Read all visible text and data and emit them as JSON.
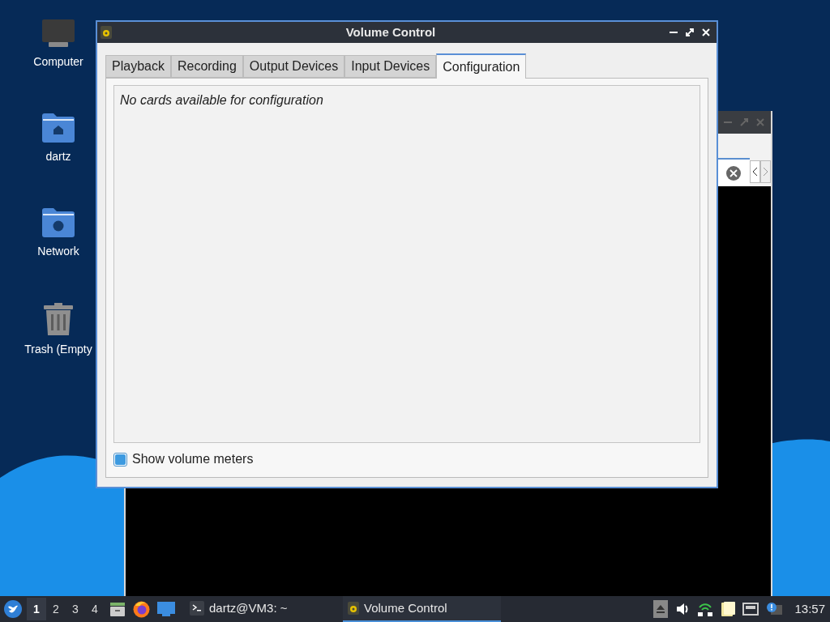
{
  "desktop_icons": [
    {
      "kind": "computer",
      "label": "Computer"
    },
    {
      "kind": "home",
      "label": "dartz"
    },
    {
      "kind": "network",
      "label": "Network"
    },
    {
      "kind": "trash",
      "label": "Trash (Empty"
    }
  ],
  "window": {
    "title": "Volume Control",
    "tabs": [
      {
        "label": "Playback",
        "selected": false
      },
      {
        "label": "Recording",
        "selected": false
      },
      {
        "label": "Output Devices",
        "selected": false
      },
      {
        "label": "Input Devices",
        "selected": false
      },
      {
        "label": "Configuration",
        "selected": true
      }
    ],
    "message": "No cards available for configuration",
    "show_meters": {
      "label": "Show volume meters",
      "checked": true
    }
  },
  "taskbar": {
    "workspaces": [
      {
        "label": "1",
        "selected": true
      },
      {
        "label": "2",
        "selected": false
      },
      {
        "label": "3",
        "selected": false
      },
      {
        "label": "4",
        "selected": false
      }
    ],
    "tasks": [
      {
        "kind": "terminal",
        "label": "dartz@VM3: ~",
        "selected": false
      },
      {
        "kind": "volume",
        "label": "Volume Control",
        "selected": true
      }
    ],
    "clock": "13:57"
  }
}
